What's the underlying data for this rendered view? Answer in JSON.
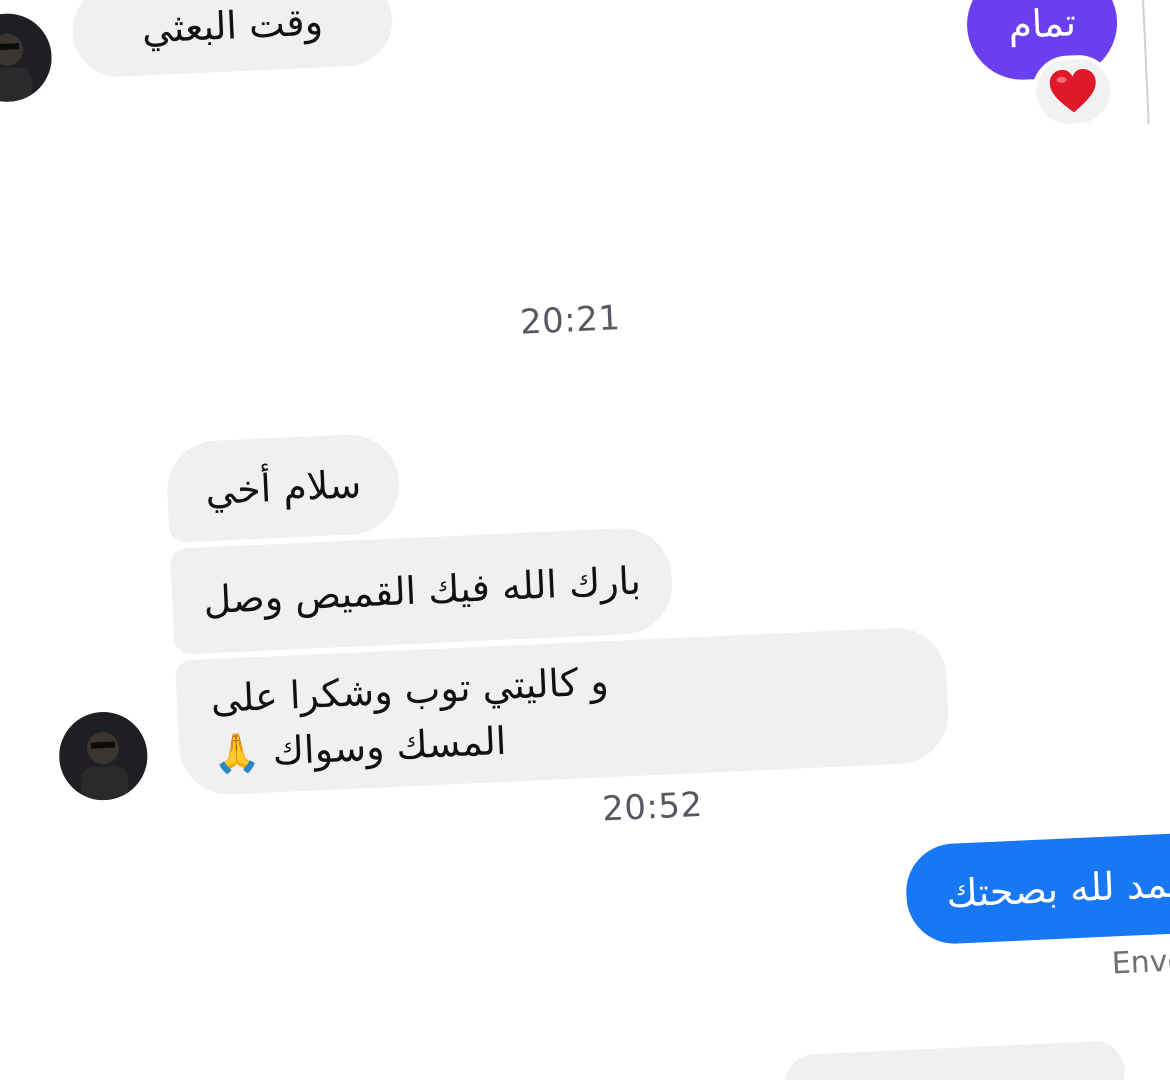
{
  "conversation": {
    "messages": {
      "top_partial_incoming": "وقت البعثي",
      "tamam": "تمام",
      "greeting": "سلام أخي",
      "thanks_shirt": "بارك الله فيك القميص وصل",
      "quality_line1": "و كاليتي توب وشكرا على",
      "quality_line2": "المسك وسواك 🙏",
      "reply_partial": "الحمد لله بصحتك"
    },
    "timestamps": {
      "first": "20:21",
      "second": "20:52"
    },
    "status": {
      "sent": "Envoyé"
    },
    "reaction": {
      "emoji": "heart-icon"
    }
  },
  "colors": {
    "incoming_bubble": "#f0f0f2",
    "purple_bubble": "#6a3ff0",
    "blue_bubble": "#1877f2",
    "heart": "#e0192a"
  }
}
